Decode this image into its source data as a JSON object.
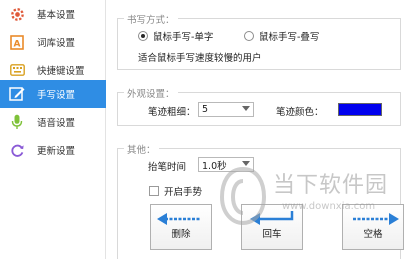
{
  "sidebar": {
    "items": [
      {
        "label": "基本设置",
        "icon": "gear-icon"
      },
      {
        "label": "词库设置",
        "icon": "dictionary-icon"
      },
      {
        "label": "快捷键设置",
        "icon": "keyboard-icon"
      },
      {
        "label": "手写设置",
        "icon": "handwriting-icon"
      },
      {
        "label": "语音设置",
        "icon": "microphone-icon"
      },
      {
        "label": "更新设置",
        "icon": "update-icon"
      }
    ],
    "active_index": 3
  },
  "writing_mode": {
    "title": "书写方式：",
    "option_single": "鼠标手写-单字",
    "option_overlap": "鼠标手写-叠写",
    "selected": "option_single",
    "description": "适合鼠标手写速度较慢的用户"
  },
  "appearance": {
    "title": "外观设置：",
    "stroke_width_label": "笔迹粗细：",
    "stroke_width_value": "5",
    "stroke_color_label": "笔迹颜色：",
    "stroke_color": "#0000ee"
  },
  "other": {
    "title": "其他：",
    "lift_time_label": "抬笔时间",
    "lift_time_value": "1.0秒",
    "gesture_label": "开启手势",
    "gesture_checked": false
  },
  "buttons": {
    "delete": "删除",
    "enter": "回车",
    "space": "空格"
  },
  "watermark": {
    "brand": "当下软件园",
    "url": "www.downxia.com"
  },
  "colors": {
    "accent": "#2f8de4",
    "arrow_blue": "#2a7fd6"
  }
}
